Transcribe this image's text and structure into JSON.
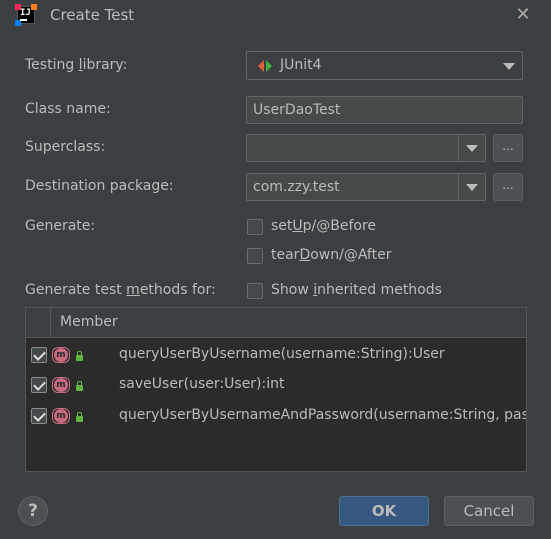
{
  "window": {
    "title": "Create Test"
  },
  "form": {
    "testing_library": {
      "label_pre": "Testing ",
      "label_mn": "l",
      "label_post": "ibrary:",
      "value": "JUnit4"
    },
    "class_name": {
      "label": "Class name:",
      "value": "UserDaoTest"
    },
    "superclass": {
      "label": "Superclass:",
      "value": "",
      "browse": "..."
    },
    "destination_package": {
      "label": "Destination package:",
      "value": "com.zzy.test",
      "browse": "..."
    },
    "generate": {
      "label": "Generate:",
      "setup": {
        "pre": "set",
        "mn": "U",
        "post": "p/@Before",
        "checked": false
      },
      "teardown": {
        "pre": "tear",
        "mn": "D",
        "post": "own/@After",
        "checked": false
      }
    },
    "methods_for": {
      "pre": "Generate test ",
      "mn": "m",
      "post": "ethods for:"
    },
    "show_inherited": {
      "pre": "Show ",
      "mn": "i",
      "post": "nherited methods",
      "checked": false
    }
  },
  "table": {
    "header": "Member",
    "rows": [
      {
        "text": "queryUserByUsername(username:String):User",
        "checked": true,
        "icon": "method-icon"
      },
      {
        "text": "saveUser(user:User):int",
        "checked": true,
        "icon": "method-icon"
      },
      {
        "text": "queryUserByUsernameAndPassword(username:String, password:String):User",
        "checked": true,
        "icon": "method-icon"
      }
    ]
  },
  "buttons": {
    "help": "?",
    "ok": "OK",
    "cancel": "Cancel"
  },
  "colors": {
    "background": "#3c3f41",
    "table_bg": "#2b2b2b",
    "ok_button": "#365880",
    "method_icon": "#c66b7f",
    "lock_icon": "#62b543"
  }
}
